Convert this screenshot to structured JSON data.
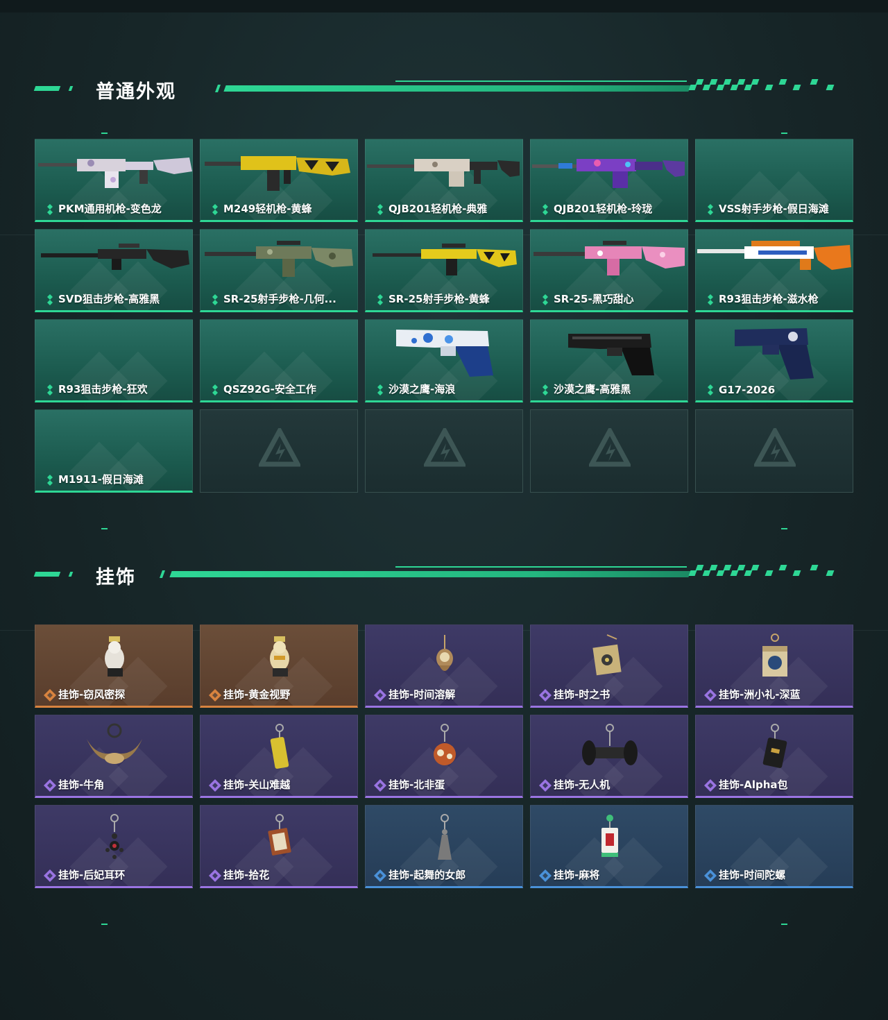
{
  "sections": {
    "skins": {
      "title": "普通外观",
      "items": [
        {
          "label": "PKM通用机枪-变色龙",
          "icon": "pkm-machine-gun-skin"
        },
        {
          "label": "M249轻机枪-黄蜂",
          "icon": "m249-light-machine-gun-skin"
        },
        {
          "label": "QJB201轻机枪-典雅",
          "icon": "qjb201-light-machine-gun-skin"
        },
        {
          "label": "QJB201轻机枪-玲珑",
          "icon": "qjb201-light-machine-gun-skin"
        },
        {
          "label": "VSS射手步枪-假日海滩",
          "icon": ""
        },
        {
          "label": "SVD狙击步枪-高雅黑",
          "icon": "svd-sniper-rifle-skin"
        },
        {
          "label": "SR-25射手步枪-几何...",
          "icon": "sr25-marksman-rifle-skin"
        },
        {
          "label": "SR-25射手步枪-黄蜂",
          "icon": "sr25-marksman-rifle-skin"
        },
        {
          "label": "SR-25-黑巧甜心",
          "icon": "sr25-marksman-rifle-skin"
        },
        {
          "label": "R93狙击步枪-滋水枪",
          "icon": "r93-sniper-rifle-skin"
        },
        {
          "label": "R93狙击步枪-狂欢",
          "icon": ""
        },
        {
          "label": "QSZ92G-安全工作",
          "icon": ""
        },
        {
          "label": "沙漠之鹰-海浪",
          "icon": "desert-eagle-pistol-skin"
        },
        {
          "label": "沙漠之鹰-高雅黑",
          "icon": "desert-eagle-pistol-skin"
        },
        {
          "label": "G17-2026",
          "icon": "g17-pistol-skin"
        },
        {
          "label": "M1911-假日海滩",
          "icon": ""
        }
      ],
      "empty_slots": 4
    },
    "charms": {
      "title": "挂饰",
      "items": [
        {
          "label": "挂饰-窃风密探",
          "rarity": "orange"
        },
        {
          "label": "挂饰-黄金视野",
          "rarity": "orange"
        },
        {
          "label": "挂饰-时间溶解",
          "rarity": "purple"
        },
        {
          "label": "挂饰-时之书",
          "rarity": "purple"
        },
        {
          "label": "挂饰-洲小礼-深蓝",
          "rarity": "purple"
        },
        {
          "label": "挂饰-牛角",
          "rarity": "purple"
        },
        {
          "label": "挂饰-关山难越",
          "rarity": "purple"
        },
        {
          "label": "挂饰-北非蛋",
          "rarity": "purple"
        },
        {
          "label": "挂饰-无人机",
          "rarity": "purple"
        },
        {
          "label": "挂饰-Alpha包",
          "rarity": "purple"
        },
        {
          "label": "挂饰-后妃耳环",
          "rarity": "purple"
        },
        {
          "label": "挂饰-拾花",
          "rarity": "purple"
        },
        {
          "label": "挂饰-起舞的女郎",
          "rarity": "blue"
        },
        {
          "label": "挂饰-麻将",
          "rarity": "blue"
        },
        {
          "label": "挂饰-时间陀螺",
          "rarity": "blue"
        }
      ]
    }
  },
  "colors": {
    "accent": "#2ed795",
    "rarity_green": "#2ed795",
    "rarity_orange": "#d8833f",
    "rarity_purple": "#9a74e2",
    "rarity_blue": "#4a91d9"
  }
}
